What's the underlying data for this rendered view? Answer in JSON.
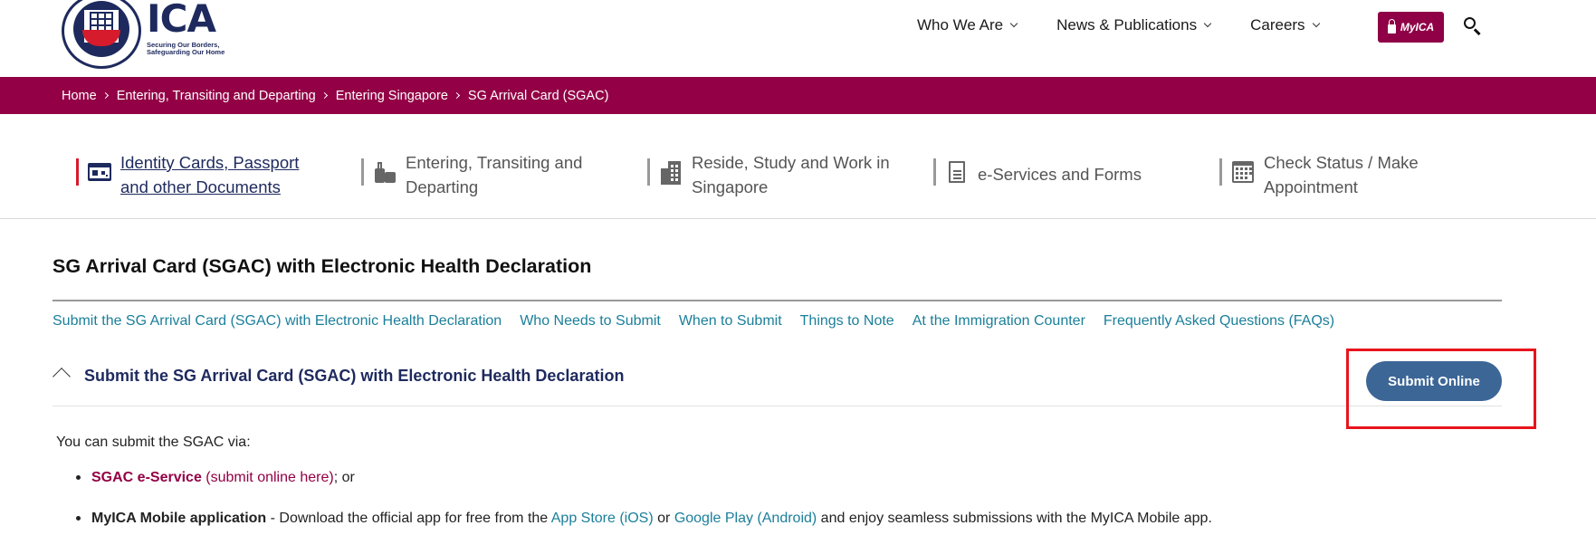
{
  "header": {
    "brand_name": "ICA",
    "brand_tagline_line1": "Securing Our Borders,",
    "brand_tagline_line2": "Safeguarding Our Home",
    "nav": [
      {
        "label": "Who We Are",
        "icon": "chevron-down-icon"
      },
      {
        "label": "News & Publications",
        "icon": "chevron-down-icon"
      },
      {
        "label": "Careers",
        "icon": "chevron-down-icon"
      }
    ],
    "myica_label": "MyICA",
    "search_icon": "search-icon",
    "accent_color": "#930045"
  },
  "breadcrumb": [
    "Home",
    "Entering, Transiting and Departing",
    "Entering Singapore",
    "SG Arrival Card (SGAC)"
  ],
  "categories": [
    {
      "line1": "Identity Cards, Passport",
      "line2": "and other Documents",
      "icon": "id-card-icon",
      "active": true
    },
    {
      "line1": "Entering, Transiting and",
      "line2": "Departing",
      "icon": "luggage-icon",
      "active": false
    },
    {
      "line1": "Reside, Study and Work in",
      "line2": "Singapore",
      "icon": "building-icon",
      "active": false
    },
    {
      "line1": "e-Services and Forms",
      "line2": "",
      "icon": "document-icon",
      "active": false
    },
    {
      "line1": "Check Status / Make",
      "line2": "Appointment",
      "icon": "calendar-icon",
      "active": false
    }
  ],
  "main": {
    "title": "SG Arrival Card (SGAC) with Electronic Health Declaration",
    "anchor_links": [
      "Submit the SG Arrival Card (SGAC) with Electronic Health Declaration",
      "Who Needs to Submit",
      "When to Submit",
      "Things to Note",
      "At the Immigration Counter",
      "Frequently Asked Questions (FAQs)"
    ],
    "accordion_title": "Submit the SG Arrival Card (SGAC) with Electronic Health Declaration",
    "submit_button": "Submit Online",
    "intro": "You can submit the SGAC via:",
    "item1": {
      "name": "SGAC e-Service",
      "link": "(submit online here)",
      "suffix": "; or"
    },
    "item2": {
      "name": "MyICA Mobile application",
      "text1": " - Download the official app for free from the ",
      "link1": "App Store (iOS)",
      "text2": " or ",
      "link2": "Google Play (Android)",
      "text3": " and enjoy seamless submissions with the MyICA Mobile app."
    }
  }
}
